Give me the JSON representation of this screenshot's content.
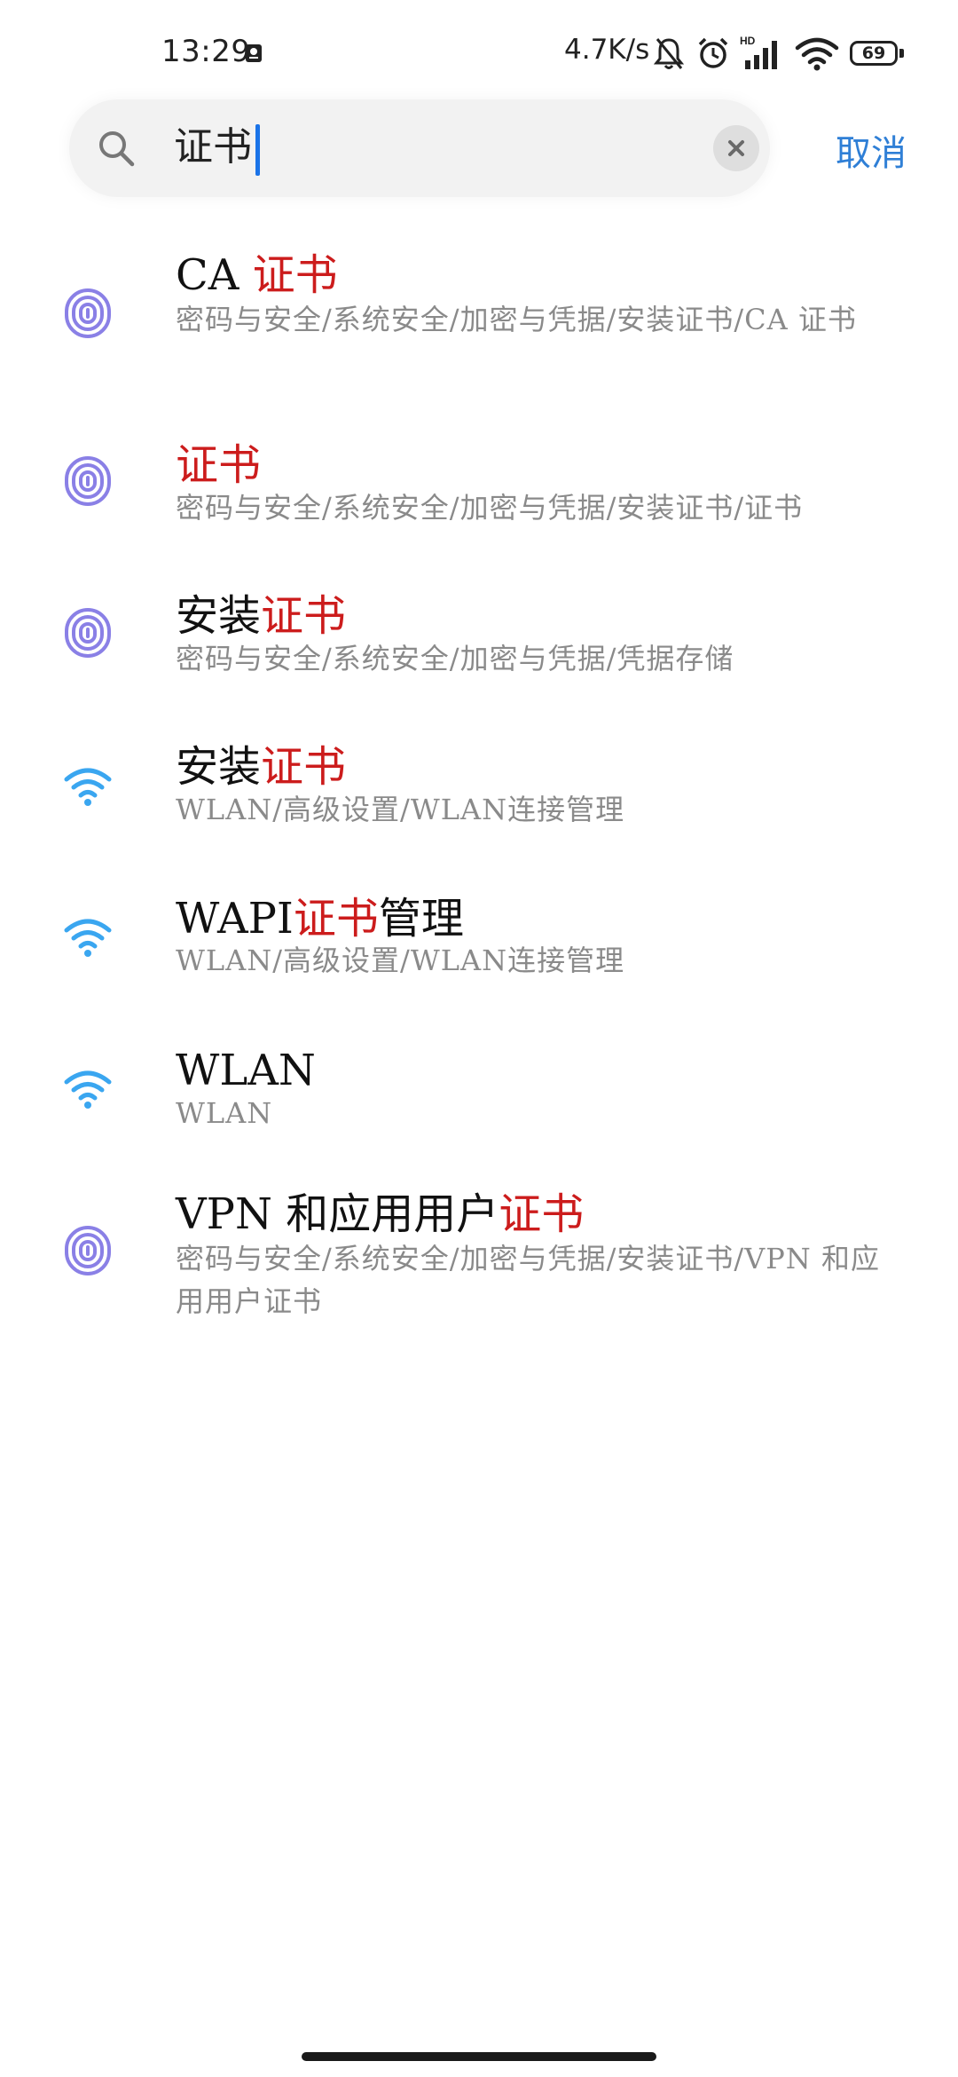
{
  "status_bar": {
    "time": "13:29",
    "net_speed": "4.7K/s",
    "battery_level": "69",
    "icons": [
      "notification-icon",
      "mute-bell-icon",
      "alarm-icon",
      "hd-signal-icon",
      "wifi-icon",
      "battery-icon"
    ]
  },
  "search": {
    "query": "证书",
    "cancel_label": "取消"
  },
  "results": [
    {
      "icon": "fingerprint-shield-icon",
      "title_pre": "CA ",
      "title_hl": "证书",
      "title_post": "",
      "path": "密码与安全/系统安全/加密与凭据/安装证书/CA 证书"
    },
    {
      "icon": "fingerprint-shield-icon",
      "title_pre": "",
      "title_hl": "证书",
      "title_post": "",
      "path": "密码与安全/系统安全/加密与凭据/安装证书/证书"
    },
    {
      "icon": "fingerprint-shield-icon",
      "title_pre": "安装",
      "title_hl": "证书",
      "title_post": "",
      "path": "密码与安全/系统安全/加密与凭据/凭据存储"
    },
    {
      "icon": "wifi-icon",
      "title_pre": "安装",
      "title_hl": "证书",
      "title_post": "",
      "path": "WLAN/高级设置/WLAN连接管理"
    },
    {
      "icon": "wifi-icon",
      "title_pre": "WAPI",
      "title_hl": "证书",
      "title_post": "管理",
      "path": "WLAN/高级设置/WLAN连接管理"
    },
    {
      "icon": "wifi-icon",
      "title_pre": "WLAN",
      "title_hl": "",
      "title_post": "",
      "path": "WLAN"
    },
    {
      "icon": "fingerprint-shield-icon",
      "title_pre": "VPN 和应用用户",
      "title_hl": "证书",
      "title_post": "",
      "path": "密码与安全/系统安全/加密与凭据/安装证书/VPN 和应用用户证书"
    }
  ],
  "colors": {
    "highlight": "#cc1c1c",
    "accent": "#2f7fd6",
    "fingerprint": "#8a80e6",
    "wifi": "#3aa6f0"
  }
}
